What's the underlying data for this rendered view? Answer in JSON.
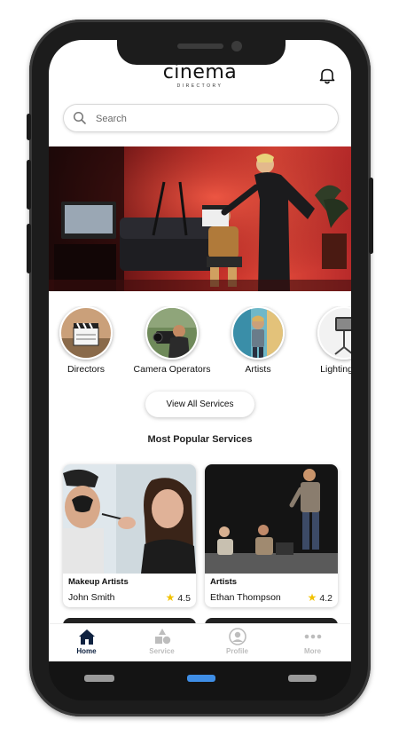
{
  "app": {
    "logo_main": "cinema",
    "logo_sub": "DIRECTORY"
  },
  "search": {
    "placeholder": "Search"
  },
  "categories": [
    {
      "label": "Directors",
      "icon": "clapperboard"
    },
    {
      "label": "Camera Operators",
      "icon": "camera-operator"
    },
    {
      "label": "Artists",
      "icon": "artist"
    },
    {
      "label": "Lighting Op",
      "icon": "light-stand"
    }
  ],
  "view_all_label": "View All Services",
  "popular_title": "Most Popular Services",
  "cards": [
    {
      "category": "Makeup Artists",
      "name": "John Smith",
      "rating": "4.5"
    },
    {
      "category": "Artists",
      "name": "Ethan Thompson",
      "rating": "4.2"
    }
  ],
  "tabs": [
    {
      "label": "Home",
      "icon": "home-icon",
      "active": true
    },
    {
      "label": "Service",
      "icon": "shapes-icon",
      "active": false
    },
    {
      "label": "Profile",
      "icon": "user-icon",
      "active": false
    },
    {
      "label": "More",
      "icon": "more-icon",
      "active": false
    }
  ],
  "colors": {
    "accent_dark": "#0f2240",
    "inactive": "#bdbdbd",
    "star": "#f2c200",
    "banner_red": "#c8302a",
    "nav_blue": "#3f8ee6"
  }
}
